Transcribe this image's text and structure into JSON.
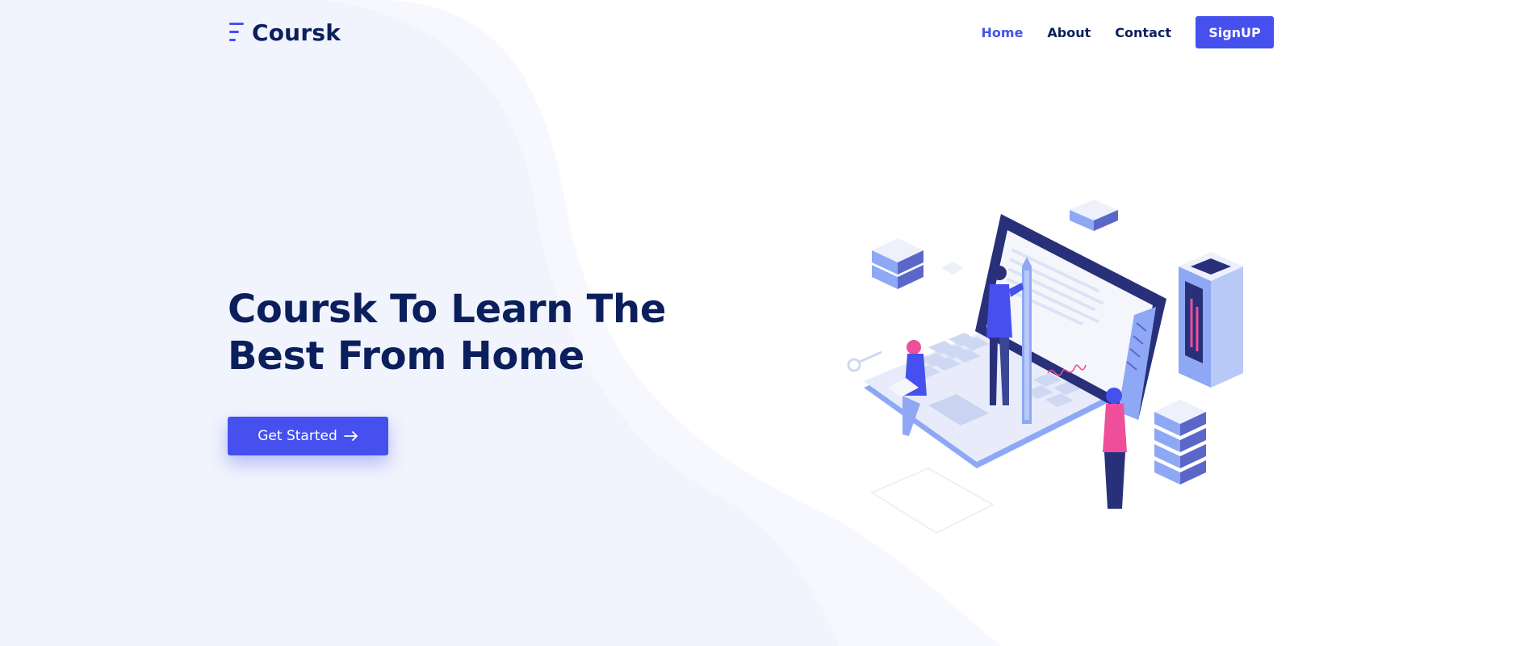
{
  "brand": {
    "name": "Coursk",
    "primary_color": "#4550ee",
    "heading_color": "#0b1f5c",
    "background_wave_color": "#f1f4fc"
  },
  "nav": {
    "links": [
      {
        "label": "Home",
        "active": true
      },
      {
        "label": "About",
        "active": false
      },
      {
        "label": "Contact",
        "active": false
      }
    ],
    "signup_label": "SignUP"
  },
  "hero": {
    "title": "Coursk To Learn The Best From Home",
    "cta_label": "Get Started",
    "cta_icon": "arrow-right-icon"
  },
  "illustration": {
    "icon": "isometric-online-learning-illustration"
  }
}
